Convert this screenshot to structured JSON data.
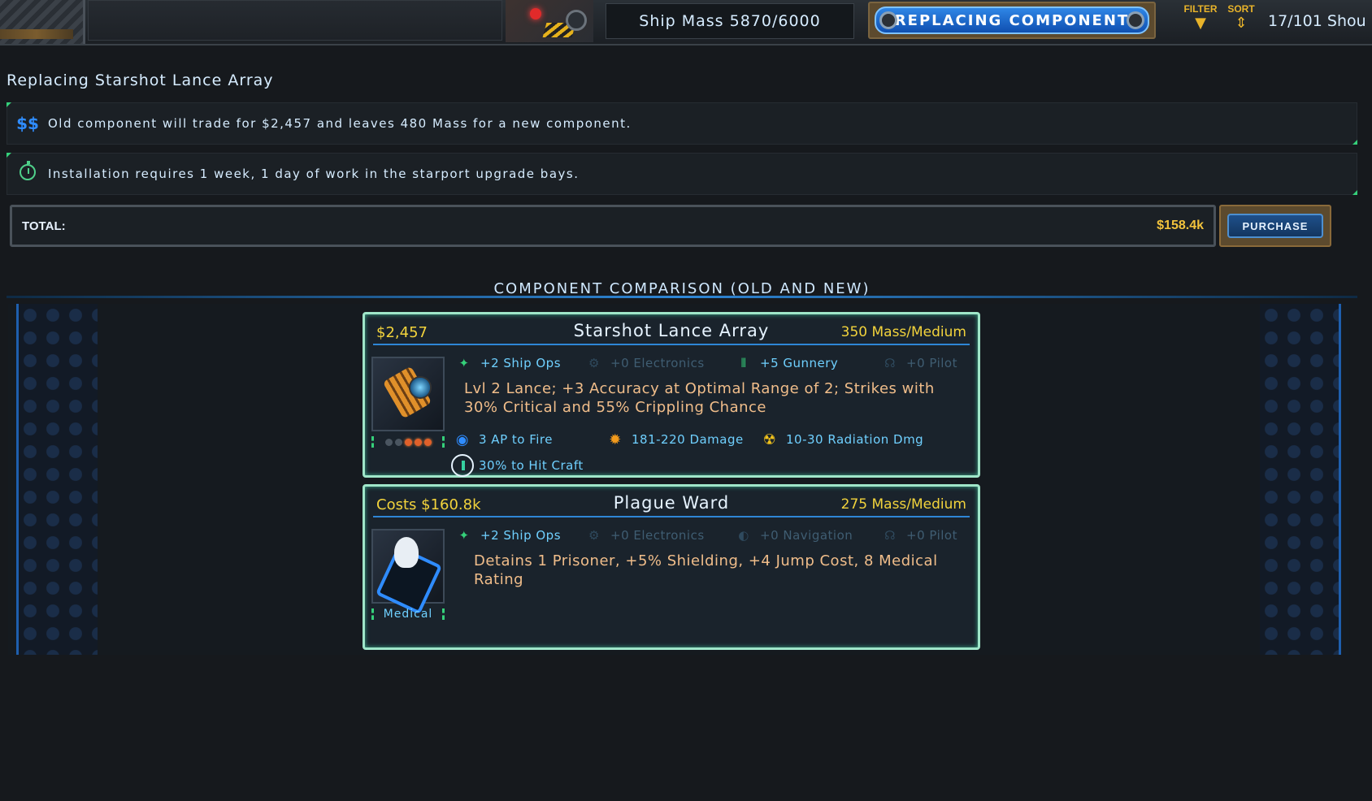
{
  "topbar": {
    "ship_mass": "Ship Mass 5870/6000",
    "mode_button": "REPLACING COMPONENT",
    "filter_label": "FILTER",
    "sort_label": "SORT",
    "count_text": "17/101 Shou"
  },
  "header": {
    "title": "Replacing Starshot Lance Array",
    "trade_icon": "$$",
    "trade_text": "Old component will trade for $2,457 and leaves 480 Mass for a new component.",
    "install_text": "Installation requires 1 week, 1 day of work in the starport upgrade bays."
  },
  "total": {
    "label": "TOTAL:",
    "value": "$158.4k",
    "purchase_label": "PURCHASE"
  },
  "comparison": {
    "title": "COMPONENT COMPARISON (OLD AND NEW)",
    "old": {
      "price": "$2,457",
      "name": "Starshot Lance Array",
      "mass": "350 Mass/Medium",
      "skills": [
        {
          "icon": "ship-ops-icon",
          "text": "+2 Ship Ops",
          "active": true
        },
        {
          "icon": "electronics-icon",
          "text": "+0 Electronics",
          "active": false
        },
        {
          "icon": "gunnery-icon",
          "text": "+5 Gunnery",
          "active": true
        },
        {
          "icon": "pilot-icon",
          "text": "+0 Pilot",
          "active": false
        }
      ],
      "description": "Lvl 2 Lance; +3 Accuracy at Optimal Range of 2; Strikes with 30% Critical and 55% Crippling Chance",
      "stats": {
        "ap": "3 AP to Fire",
        "damage": "181-220 Damage",
        "radiation": "10-30 Radiation Dmg",
        "hit": "30% to Hit Craft"
      },
      "rank_dots_filled": 3,
      "rank_dots_total": 5
    },
    "new": {
      "price": "Costs $160.8k",
      "name": "Plague Ward",
      "mass": "275 Mass/Medium",
      "skills": [
        {
          "icon": "ship-ops-icon",
          "text": "+2 Ship Ops",
          "active": true
        },
        {
          "icon": "electronics-icon",
          "text": "+0 Electronics",
          "active": false
        },
        {
          "icon": "navigation-icon",
          "text": "+0 Navigation",
          "active": false
        },
        {
          "icon": "pilot-icon",
          "text": "+0 Pilot",
          "active": false
        }
      ],
      "description": "Detains 1 Prisoner, +5% Shielding, +4 Jump Cost, 8 Medical Rating",
      "category": "Medical"
    }
  },
  "colors": {
    "accent_blue": "#2f86e6",
    "gold": "#f2d33c",
    "cyan_text": "#6fd0ff",
    "desc_orange": "#f0bd8a",
    "card_border": "#9fe6c9"
  }
}
